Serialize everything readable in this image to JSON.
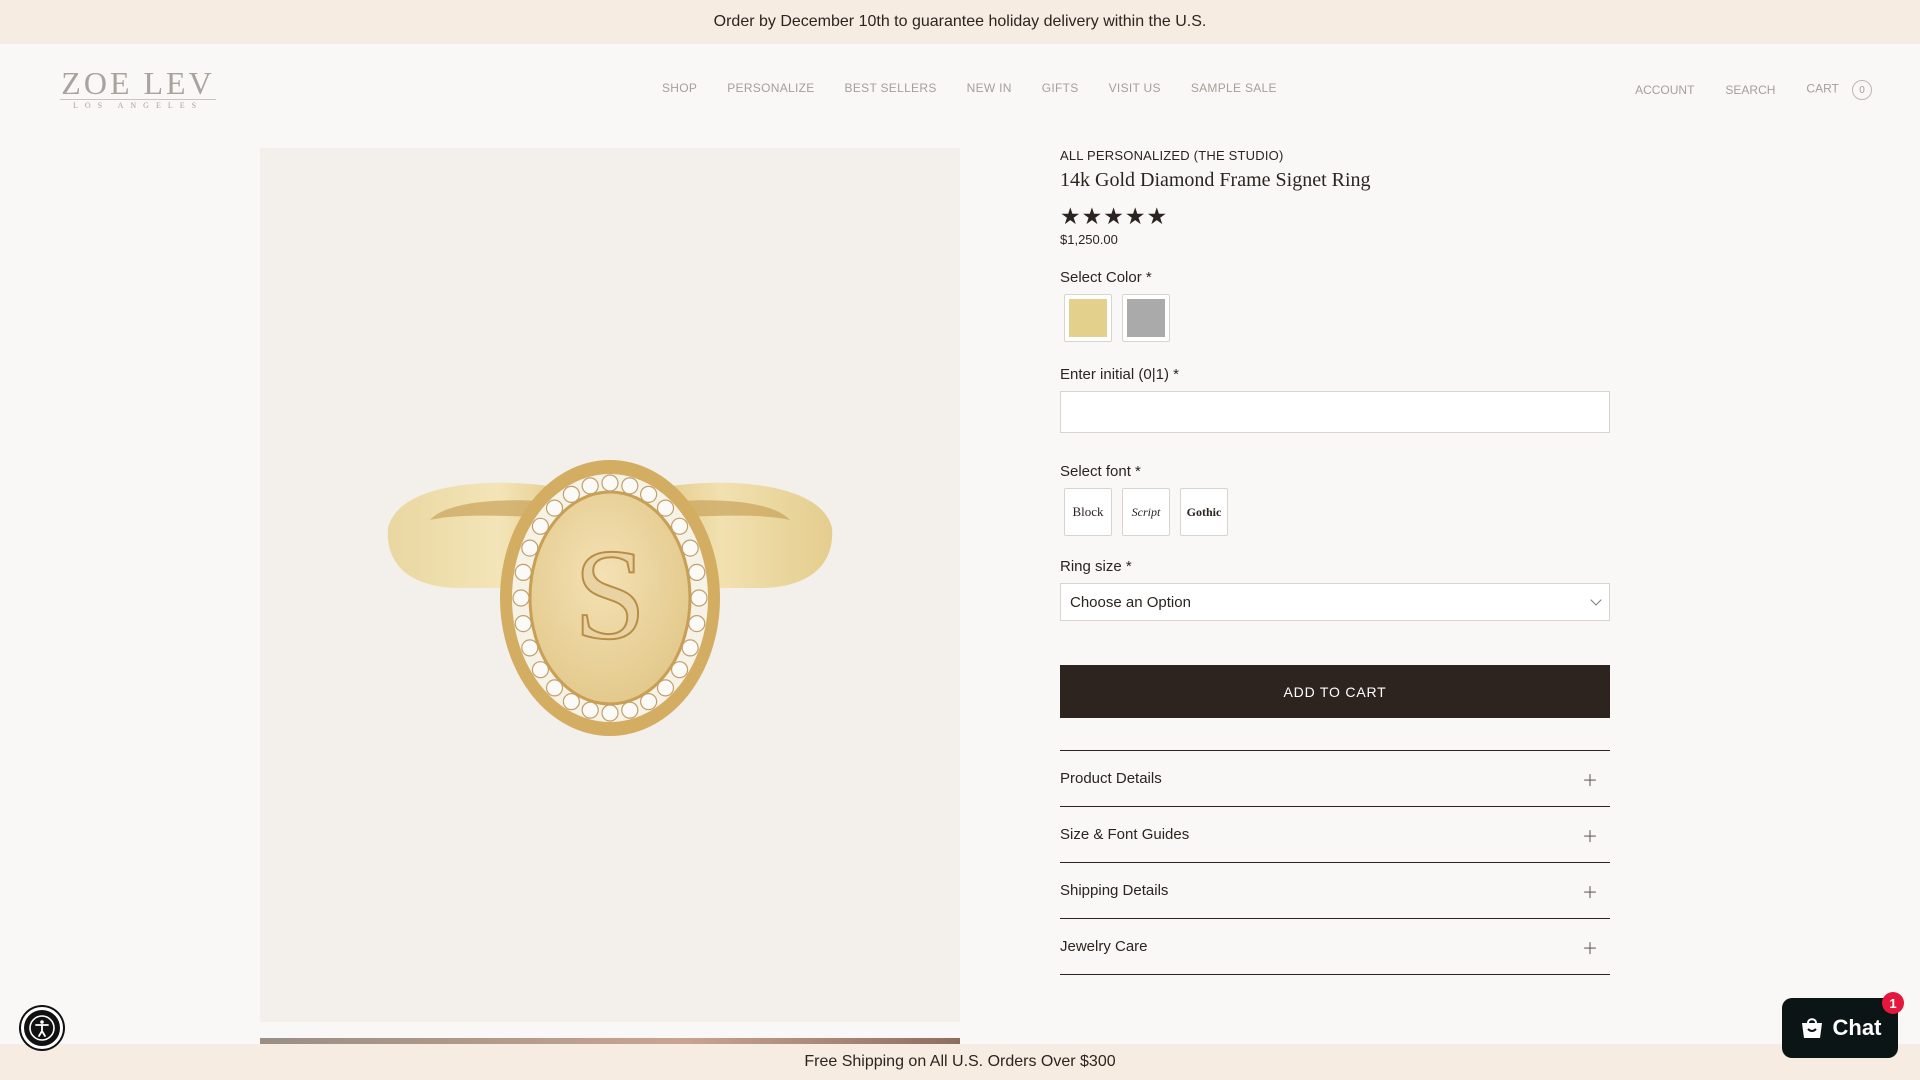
{
  "announcement": "Order by December 10th to guarantee holiday delivery within the U.S.",
  "brand": {
    "name": "ZOE LEV",
    "sub": "LOS ANGELES"
  },
  "nav": [
    "SHOP",
    "PERSONALIZE",
    "BEST SELLERS",
    "NEW IN",
    "GIFTS",
    "VISIT US",
    "SAMPLE SALE"
  ],
  "util": {
    "account": "ACCOUNT",
    "search": "SEARCH",
    "cart": "CART",
    "cart_count": "0"
  },
  "product": {
    "collection": "ALL PERSONALIZED (THE STUDIO)",
    "title": "14k Gold Diamond Frame Signet Ring",
    "stars": "★★★★★",
    "rating": 5,
    "price": "$1,250.00",
    "color_label": "Select Color *",
    "colors": [
      "#e2d08c",
      "#aaaaaa"
    ],
    "initial_label": "Enter initial (0|1) *",
    "initial_value": "",
    "font_label": "Select font *",
    "fonts": [
      "Block",
      "Script",
      "Gothic"
    ],
    "ring_label": "Ring size *",
    "ring_value": "Choose an Option",
    "add_to_cart": "ADD TO CART",
    "accordion": [
      "Product Details",
      "Size & Font Guides",
      "Shipping Details",
      "Jewelry Care"
    ],
    "ring_initial": "S"
  },
  "footer_banner": "Free Shipping on All U.S. Orders Over $300",
  "chat": {
    "label": "Chat",
    "badge": "1"
  },
  "colors": {
    "accent": "#2d2420",
    "banner": "#f7ece1",
    "bg": "#f9f8f6"
  }
}
